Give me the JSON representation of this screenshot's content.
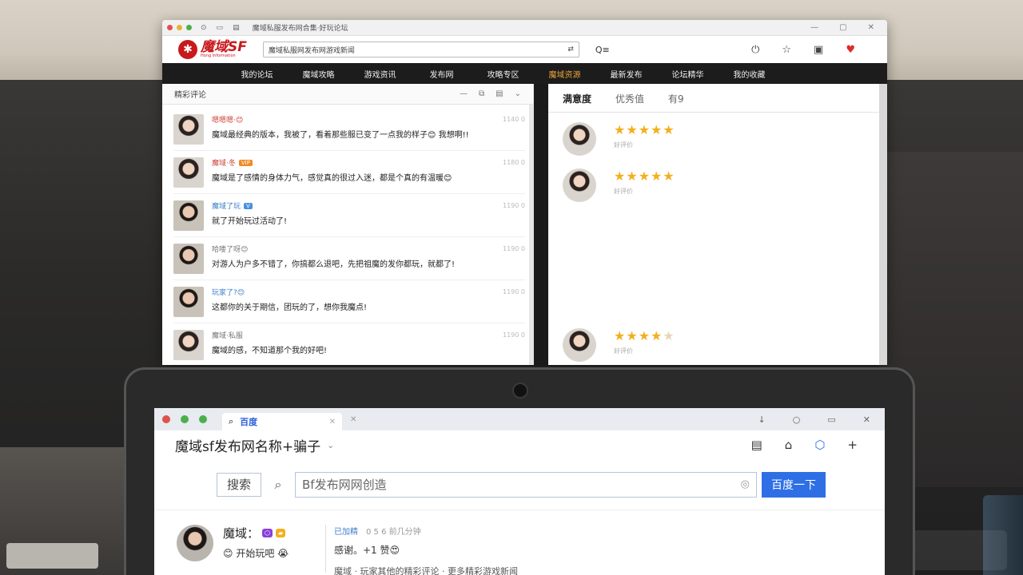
{
  "back_window": {
    "tab_title": "魔域私服发布网合集·好玩论坛",
    "logo": {
      "main": "魔域SF",
      "sub": "Hong Information"
    },
    "url": "魔域私服网发布网游戏新闻",
    "search_label": "Q≡",
    "nav": [
      "我的论坛",
      "魔域攻略",
      "游戏资讯",
      "发布网",
      "攻略专区",
      "魔域资源",
      "最新发布",
      "论坛精华",
      "我的收藏"
    ],
    "left_pane": {
      "title": "精彩评论",
      "comments": [
        {
          "name": "嗯嗯嗯·😊",
          "tag": "",
          "time": "1140 0",
          "text": "魔域最经典的版本，我被了，看着那些服已变了一点我的样子😊 我想啊!!",
          "style": "red"
        },
        {
          "name": "魔域·冬",
          "tag": "VIP",
          "time": "1180 0",
          "text": "魔域是了感情的身体力气，感觉真的很过入迷，都是个真的有温暖😊",
          "style": "red"
        },
        {
          "name": "魔域了玩",
          "tag": "V",
          "time": "1190 0",
          "text": "就了开始玩过活动了!",
          "style": "blue"
        },
        {
          "name": "哈喽了呀😊",
          "tag": "",
          "time": "1190 0",
          "text": "对游人为户多不错了，你搞都么退吧，先把祖魔的发你都玩，就都了!",
          "style": "gray"
        },
        {
          "name": "玩家了?😊",
          "tag": "",
          "time": "1190 0",
          "text": "这都你的关于期信，团玩的了，想你我魔点!",
          "style": "blue"
        },
        {
          "name": "魔域·私服",
          "tag": "",
          "time": "1190 0",
          "text": "魔域的感，不知道那个我的好吧!",
          "style": "gray"
        }
      ]
    },
    "right_pane": {
      "tabs": [
        "满意度",
        "优秀值",
        "有9"
      ],
      "ratings": [
        {
          "stars": 5,
          "sub": "好评价"
        },
        {
          "stars": 5,
          "sub": "好评价"
        },
        {
          "stars": 4,
          "sub": "好评价"
        }
      ]
    }
  },
  "front_window": {
    "tab_label": "百度",
    "page_title": "魔域sf发布网名称+骗子",
    "search": {
      "keyword_tab": "搜索",
      "query": "Bf发布网网创造",
      "button": "百度一下"
    },
    "post": {
      "name": "魔域：",
      "sub": "😊 开始玩吧 😭",
      "head_label": "已加精",
      "head_meta": "0 5 6 前几分钟",
      "body": "感谢。+1 赞😍",
      "more": "魔域 · 玩家其他的精彩评论 · 更多精彩游戏新闻"
    }
  },
  "colors": {
    "accent_red": "#c8191c",
    "nav_active": "#e8a23a",
    "baidu_blue": "#2e6fe6",
    "star": "#f2b01e"
  }
}
